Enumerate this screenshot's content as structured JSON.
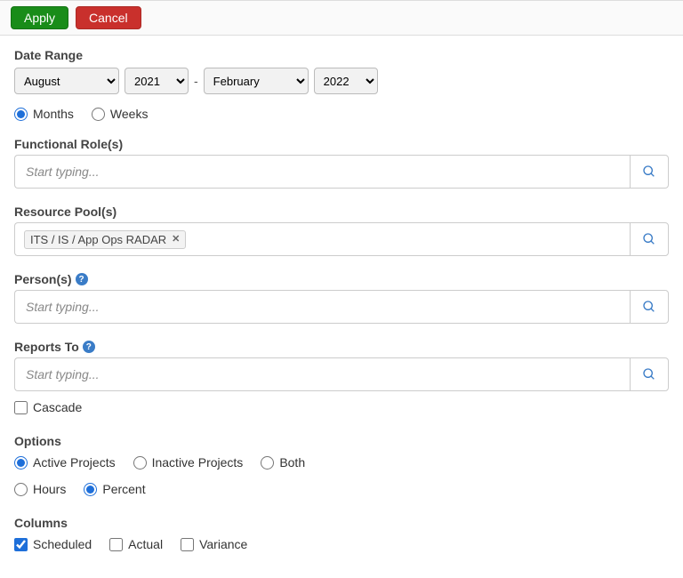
{
  "toolbar": {
    "apply_label": "Apply",
    "cancel_label": "Cancel"
  },
  "date_range": {
    "label": "Date Range",
    "start_month": "August",
    "start_year": "2021",
    "end_month": "February",
    "end_year": "2022",
    "granularity": {
      "months_label": "Months",
      "weeks_label": "Weeks",
      "selected": "months"
    }
  },
  "functional_roles": {
    "label": "Functional Role(s)",
    "placeholder": "Start typing...",
    "tags": []
  },
  "resource_pools": {
    "label": "Resource Pool(s)",
    "placeholder": "",
    "tags": [
      "ITS / IS / App Ops RADAR"
    ]
  },
  "persons": {
    "label": "Person(s)",
    "placeholder": "Start typing...",
    "tags": []
  },
  "reports_to": {
    "label": "Reports To",
    "placeholder": "Start typing...",
    "tags": []
  },
  "cascade": {
    "label": "Cascade",
    "checked": false
  },
  "options": {
    "label": "Options",
    "project_filter": {
      "active_label": "Active Projects",
      "inactive_label": "Inactive Projects",
      "both_label": "Both",
      "selected": "active"
    },
    "unit": {
      "hours_label": "Hours",
      "percent_label": "Percent",
      "selected": "percent"
    }
  },
  "columns": {
    "label": "Columns",
    "scheduled_label": "Scheduled",
    "actual_label": "Actual",
    "variance_label": "Variance",
    "scheduled_checked": true,
    "actual_checked": false,
    "variance_checked": false
  }
}
